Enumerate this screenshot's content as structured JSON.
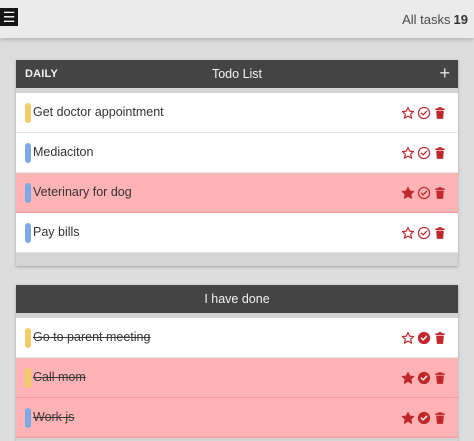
{
  "header": {
    "menu_icon": "hamburger-menu-icon",
    "task_count_label": "All tasks",
    "task_count": "19"
  },
  "colors": {
    "star": "#c1272d",
    "check": "#c1272d",
    "trash": "#c1272d",
    "yellow": "#f3cc66",
    "blue": "#7ea9e8",
    "highlight": "#ffb3b4"
  },
  "todo_panel": {
    "left_label": "DAILY",
    "title": "Todo List",
    "add_label": "+",
    "items": [
      {
        "text": "Get doctor appointment",
        "color": "yellow",
        "starred": false,
        "done": false,
        "highlighted": false
      },
      {
        "text": "Mediaciton",
        "color": "blue",
        "starred": false,
        "done": false,
        "highlighted": false
      },
      {
        "text": "Veterinary for dog",
        "color": "blue",
        "starred": true,
        "done": false,
        "highlighted": true
      },
      {
        "text": "Pay bills",
        "color": "blue",
        "starred": false,
        "done": false,
        "highlighted": false
      }
    ]
  },
  "done_panel": {
    "title": "I have done",
    "items": [
      {
        "text": "Go to parent meeting",
        "color": "yellow",
        "starred": false,
        "done": true,
        "highlighted": false
      },
      {
        "text": "Call mom",
        "color": "yellow",
        "starred": true,
        "done": true,
        "highlighted": true
      },
      {
        "text": "Work js",
        "color": "blue",
        "starred": true,
        "done": true,
        "highlighted": true
      }
    ]
  }
}
